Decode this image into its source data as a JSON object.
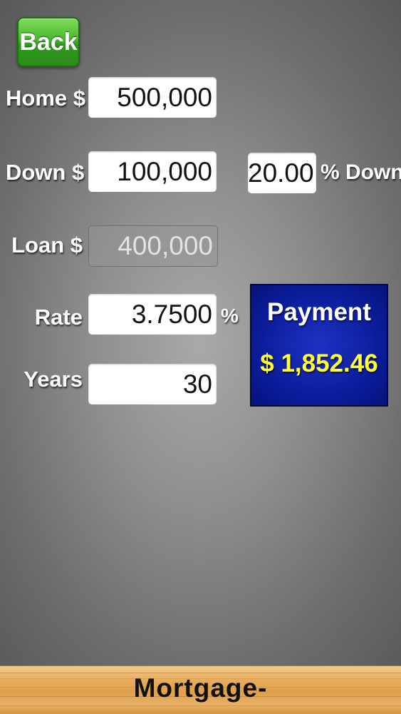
{
  "back_button": {
    "label": "Back"
  },
  "fields": {
    "home": {
      "label": "Home $",
      "value": "500,000"
    },
    "down": {
      "label": "Down $",
      "value": "100,000"
    },
    "down_percent": {
      "value": "20.00",
      "suffix": "% Down"
    },
    "loan": {
      "label": "Loan $",
      "value": "400,000"
    },
    "rate": {
      "label": "Rate",
      "value": "3.7500",
      "suffix": "%"
    },
    "years": {
      "label": "Years",
      "value": "30"
    }
  },
  "payment": {
    "title": "Payment",
    "value": "$ 1,852.46"
  },
  "bottom_bar": {
    "title": "Mortgage-"
  },
  "colors": {
    "back_button": "#47b82c",
    "payment_box": "#0c1d9c",
    "payment_value": "#ffff33",
    "bottom_bar": "#e3a552"
  }
}
